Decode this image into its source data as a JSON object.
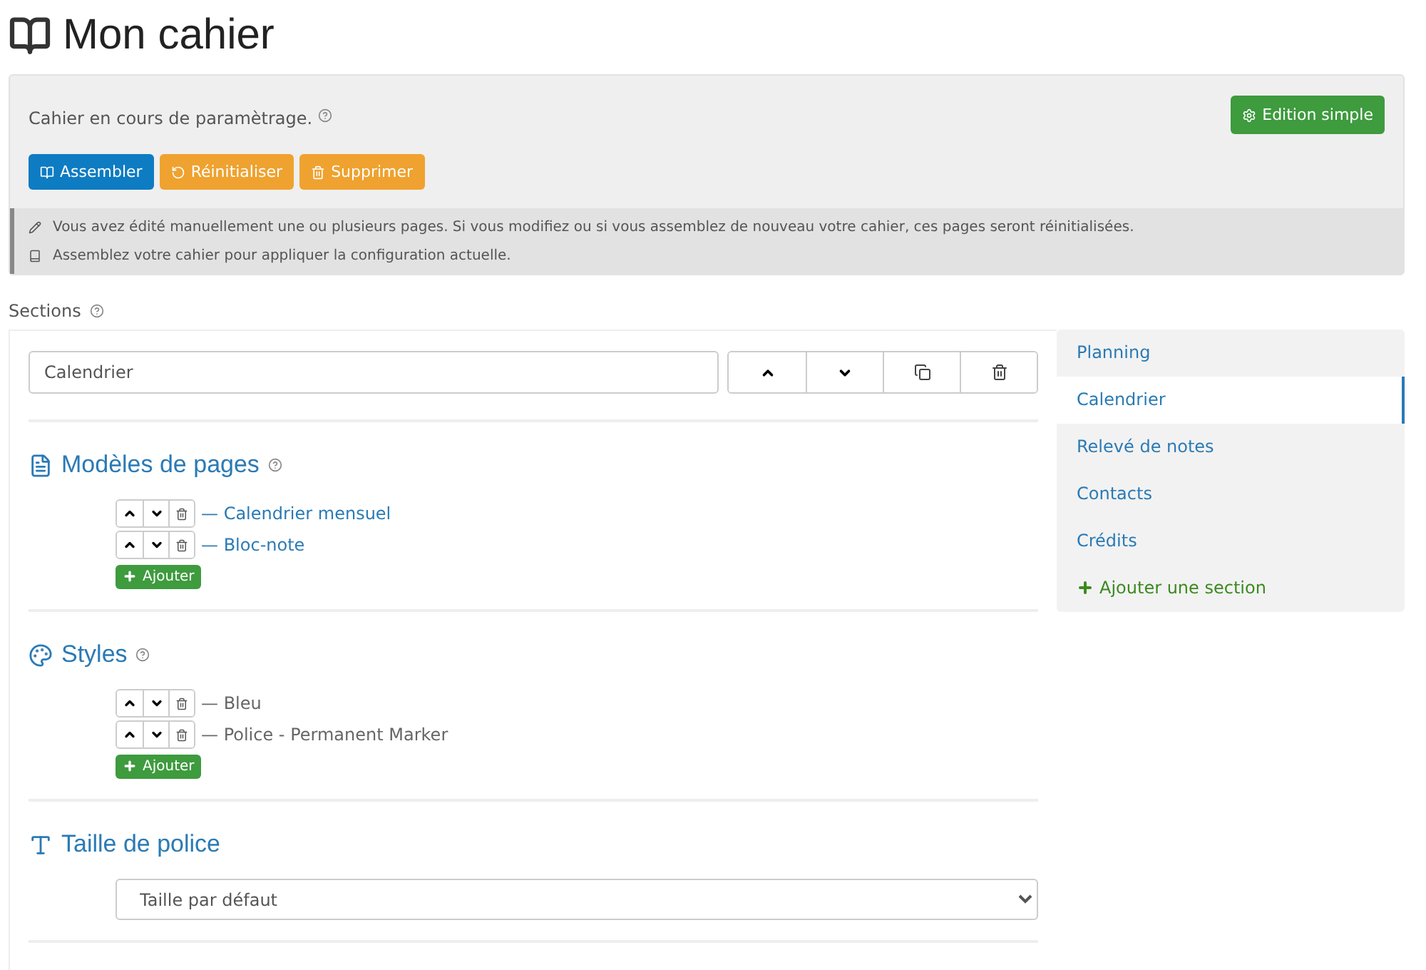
{
  "page_title": "Mon cahier",
  "status": {
    "text": "Cahier en cours de paramètrage.",
    "help": true
  },
  "mode_button": "Edition simple",
  "actions": [
    {
      "label": "Assembler",
      "kind": "primary"
    },
    {
      "label": "Réinitialiser",
      "kind": "warning"
    },
    {
      "label": "Supprimer",
      "kind": "warning"
    }
  ],
  "notices": [
    "Vous avez édité manuellement une ou plusieurs pages. Si vous modifiez ou si vous assemblez de nouveau votre cahier, ces pages seront réinitialisées.",
    "Assemblez votre cahier pour appliquer la configuration actuelle."
  ],
  "sections_label": {
    "text": "Sections",
    "help": true
  },
  "section_name": {
    "value": "Calendrier"
  },
  "blocks": [
    {
      "title": "Modèles de pages",
      "help": true,
      "kind": "links",
      "items": [
        "— Calendrier mensuel",
        "— Bloc-note"
      ],
      "add_button": "Ajouter"
    },
    {
      "title": "Styles",
      "help": true,
      "kind": "list",
      "items": [
        "— Bleu",
        "— Police - Permanent Marker"
      ],
      "add_button": "Ajouter"
    },
    {
      "title": "Taille de police",
      "help": false,
      "kind": "select",
      "value": "Taille par défaut"
    }
  ],
  "nav": [
    {
      "label": "Planning",
      "kind": "section",
      "selected": false
    },
    {
      "label": "Calendrier",
      "kind": "section",
      "selected": true
    },
    {
      "label": "Relevé de notes",
      "kind": "section",
      "selected": false
    },
    {
      "label": "Contacts",
      "kind": "section",
      "selected": false
    },
    {
      "label": "Crédits",
      "kind": "section",
      "selected": false
    },
    {
      "label": "Ajouter une section",
      "kind": "add",
      "selected": false
    }
  ]
}
